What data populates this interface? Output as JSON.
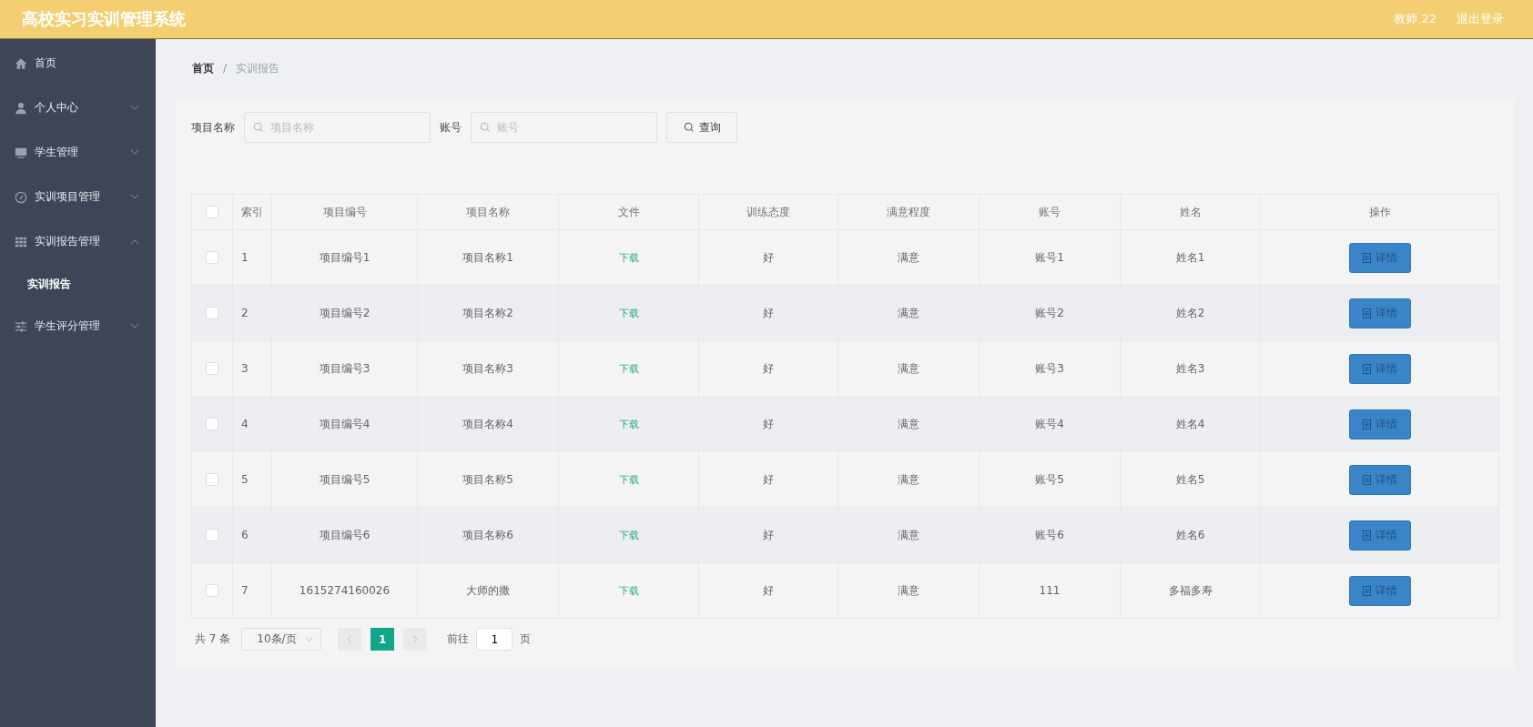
{
  "header": {
    "title": "高校实习实训管理系统",
    "user": "教师 22",
    "logout": "退出登录"
  },
  "sidebar": {
    "items": [
      {
        "label": "首页",
        "selected": false
      },
      {
        "label": "个人中心",
        "selected": false,
        "expanded": false
      },
      {
        "label": "学生管理",
        "selected": false,
        "expanded": false
      },
      {
        "label": "实训项目管理",
        "selected": false,
        "expanded": false
      },
      {
        "label": "实训报告管理",
        "selected": false,
        "expanded": true,
        "children": [
          {
            "label": "实训报告",
            "selected": true
          }
        ]
      },
      {
        "label": "学生评分管理",
        "selected": false,
        "expanded": false
      }
    ]
  },
  "breadcrumb": [
    "首页",
    "实训报告"
  ],
  "breadcrumb_separator": "/",
  "search": {
    "fields": [
      {
        "label": "项目名称",
        "placeholder": "项目名称"
      },
      {
        "label": "账号",
        "placeholder": "账号"
      }
    ],
    "button": "查询"
  },
  "table": {
    "select_all": {
      "checked": false
    },
    "columns": [
      "索引",
      "项目编号",
      "项目名称",
      "文件",
      "训练态度",
      "满意程度",
      "账号",
      "姓名",
      "操作"
    ],
    "rows": [
      {
        "checked": false,
        "cells": [
          "1",
          "项目编号1",
          "项目名称1",
          "下载",
          "好",
          "满意",
          "账号1",
          "姓名1"
        ],
        "action": "详情"
      },
      {
        "checked": false,
        "cells": [
          "2",
          "项目编号2",
          "项目名称2",
          "下载",
          "好",
          "满意",
          "账号2",
          "姓名2"
        ],
        "action": "详情"
      },
      {
        "checked": false,
        "cells": [
          "3",
          "项目编号3",
          "项目名称3",
          "下载",
          "好",
          "满意",
          "账号3",
          "姓名3"
        ],
        "action": "详情"
      },
      {
        "checked": false,
        "cells": [
          "4",
          "项目编号4",
          "项目名称4",
          "下载",
          "好",
          "满意",
          "账号4",
          "姓名4"
        ],
        "action": "详情"
      },
      {
        "checked": false,
        "cells": [
          "5",
          "项目编号5",
          "项目名称5",
          "下载",
          "好",
          "满意",
          "账号5",
          "姓名5"
        ],
        "action": "详情"
      },
      {
        "checked": false,
        "cells": [
          "6",
          "项目编号6",
          "项目名称6",
          "下载",
          "好",
          "满意",
          "账号6",
          "姓名6"
        ],
        "action": "详情"
      },
      {
        "checked": false,
        "cells": [
          "7",
          "1615274160026",
          "大师的撒",
          "下载",
          "好",
          "满意",
          "111",
          "多福多寿"
        ],
        "action": "详情"
      }
    ]
  },
  "pagination": {
    "total": "共 7 条",
    "page_size": "10条/页",
    "pages": [
      {
        "label": "1",
        "selected": true
      }
    ],
    "goto_label": "前往",
    "goto_value": "1",
    "goto_suffix": "页"
  }
}
